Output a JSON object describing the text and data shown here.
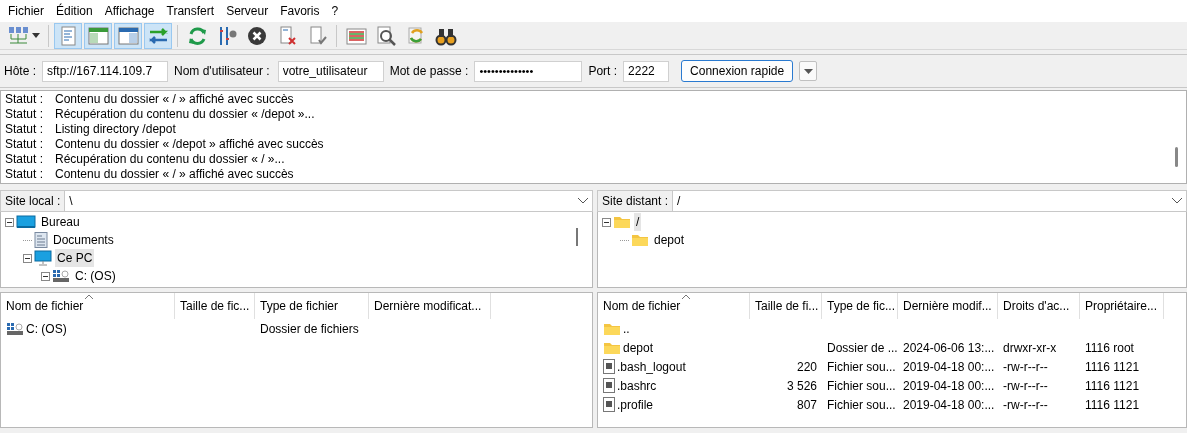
{
  "menu": [
    "Fichier",
    "Édition",
    "Affichage",
    "Transfert",
    "Serveur",
    "Favoris",
    "?"
  ],
  "toolbar": [
    {
      "on": false
    },
    {
      "on": true
    },
    {
      "on": true
    },
    {
      "on": true
    },
    {
      "on": true
    },
    {
      "on": false
    },
    {
      "on": false
    },
    {
      "on": false
    },
    {
      "on": false
    },
    {
      "on": false
    },
    {
      "on": false
    },
    {
      "on": false
    },
    {
      "on": false
    },
    {
      "on": false
    }
  ],
  "quickconnect": {
    "host_label": "Hôte :",
    "host": "sftp://167.114.109.7",
    "user_label": "Nom d'utilisateur :",
    "user": "votre_utilisateur",
    "pass_label": "Mot de passe :",
    "password": "••••••••••••••",
    "port_label": "Port :",
    "port": "2222",
    "button": "Connexion rapide"
  },
  "log": [
    {
      "label": "Statut :",
      "message": "Contenu du dossier « / » affiché avec succès"
    },
    {
      "label": "Statut :",
      "message": "Récupération du contenu du dossier « /depot »..."
    },
    {
      "label": "Statut :",
      "message": "Listing directory /depot"
    },
    {
      "label": "Statut :",
      "message": "Contenu du dossier « /depot » affiché avec succès"
    },
    {
      "label": "Statut :",
      "message": "Récupération du contenu du dossier « / »..."
    },
    {
      "label": "Statut :",
      "message": "Contenu du dossier « / » affiché avec succès"
    }
  ],
  "local": {
    "label": "Site local :",
    "path": "\\",
    "tree": [
      {
        "label": "Bureau",
        "kind": "desktop",
        "selected": false,
        "expanded": true,
        "children": [
          {
            "label": "Documents",
            "kind": "document",
            "selected": false,
            "expanded": false
          },
          {
            "label": "Ce PC",
            "kind": "computer",
            "selected": true,
            "expanded": true,
            "children": [
              {
                "label": "C: (OS)",
                "kind": "drive",
                "selected": false,
                "expanded": true
              }
            ]
          }
        ]
      }
    ],
    "columns": [
      "Nom de fichier",
      "Taille de fic...",
      "Type de fichier",
      "Dernière modificat..."
    ],
    "files": [
      {
        "kind": "drive",
        "cells": [
          "C: (OS)",
          "",
          "Dossier de fichiers",
          ""
        ]
      }
    ]
  },
  "remote": {
    "label": "Site distant :",
    "path": "/",
    "tree": [
      {
        "label": "/",
        "kind": "folder",
        "selected": true,
        "expanded": true,
        "children": [
          {
            "label": "depot",
            "kind": "folder",
            "selected": false,
            "expanded": false
          }
        ]
      }
    ],
    "columns": [
      "Nom de fichier",
      "Taille de fi...",
      "Type de fic...",
      "Dernière modif...",
      "Droits d'ac...",
      "Propriétaire..."
    ],
    "files": [
      {
        "kind": "folder",
        "cells": [
          "..",
          "",
          "",
          "",
          "",
          ""
        ]
      },
      {
        "kind": "folder",
        "cells": [
          "depot",
          "",
          "Dossier de ...",
          "2024-06-06 13:...",
          "drwxr-xr-x",
          "1116 root"
        ]
      },
      {
        "kind": "file",
        "cells": [
          ".bash_logout",
          "220",
          "Fichier sou...",
          "2019-04-18 00:...",
          "-rw-r--r--",
          "1116 1121"
        ]
      },
      {
        "kind": "file",
        "cells": [
          ".bashrc",
          "3 526",
          "Fichier sou...",
          "2019-04-18 00:...",
          "-rw-r--r--",
          "1116 1121"
        ]
      },
      {
        "kind": "file",
        "cells": [
          ".profile",
          "807",
          "Fichier sou...",
          "2019-04-18 00:...",
          "-rw-r--r--",
          "1116 1121"
        ]
      }
    ]
  }
}
